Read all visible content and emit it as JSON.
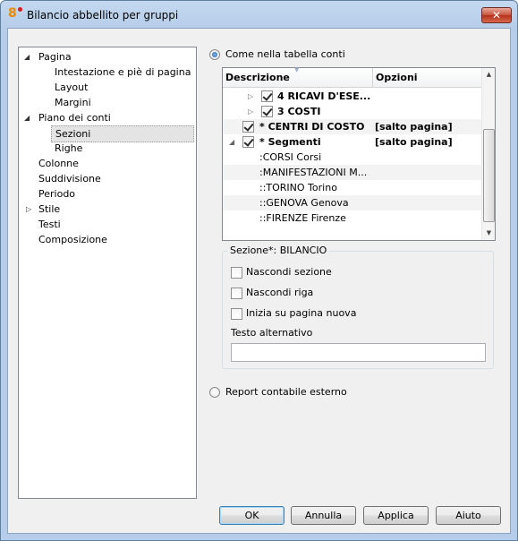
{
  "window": {
    "title": "Bilancio abbellito per gruppi",
    "app_icon": "banana-app-icon",
    "close_label": "✕"
  },
  "tree": {
    "items": [
      {
        "label": "Pagina",
        "expanded": true
      },
      {
        "label": "Intestazione e piè di pagina"
      },
      {
        "label": "Layout"
      },
      {
        "label": "Margini"
      },
      {
        "label": "Piano dei conti",
        "expanded": true
      },
      {
        "label": "Sezioni",
        "selected": true
      },
      {
        "label": "Righe"
      },
      {
        "label": "Colonne"
      },
      {
        "label": "Suddivisione"
      },
      {
        "label": "Periodo"
      },
      {
        "label": "Stile",
        "expanded": false
      },
      {
        "label": "Testi"
      },
      {
        "label": "Composizione"
      }
    ]
  },
  "source": {
    "option_table": "Come nella tabella conti",
    "option_table_selected": true,
    "option_external": "Report contabile esterno",
    "option_external_selected": false
  },
  "grid": {
    "columns": [
      "Descrizione",
      "Opzioni"
    ],
    "rows": [
      {
        "desc": "4 RICAVI D'ESE...",
        "options": "",
        "checked": true,
        "bold": true
      },
      {
        "desc": "3 COSTI",
        "options": "",
        "checked": true,
        "bold": true
      },
      {
        "desc": "* CENTRI DI COSTO",
        "options": "[salto pagina]",
        "checked": true,
        "bold": true
      },
      {
        "desc": "* Segmenti",
        "options": "[salto pagina]",
        "checked": true,
        "bold": true
      },
      {
        "desc": ":CORSI Corsi",
        "options": ""
      },
      {
        "desc": ":MANIFESTAZIONI M...",
        "options": ""
      },
      {
        "desc": "::TORINO Torino",
        "options": ""
      },
      {
        "desc": "::GENOVA Genova",
        "options": ""
      },
      {
        "desc": "::FIRENZE Firenze",
        "options": ""
      }
    ]
  },
  "section": {
    "title": "Sezione*: BILANCIO",
    "hide_section": "Nascondi sezione",
    "hide_row": "Nascondi riga",
    "new_page": "Inizia su pagina nuova",
    "alt_text_label": "Testo alternativo",
    "alt_text_value": ""
  },
  "buttons": {
    "ok": "OK",
    "cancel": "Annulla",
    "apply": "Applica",
    "help": "Aiuto"
  }
}
